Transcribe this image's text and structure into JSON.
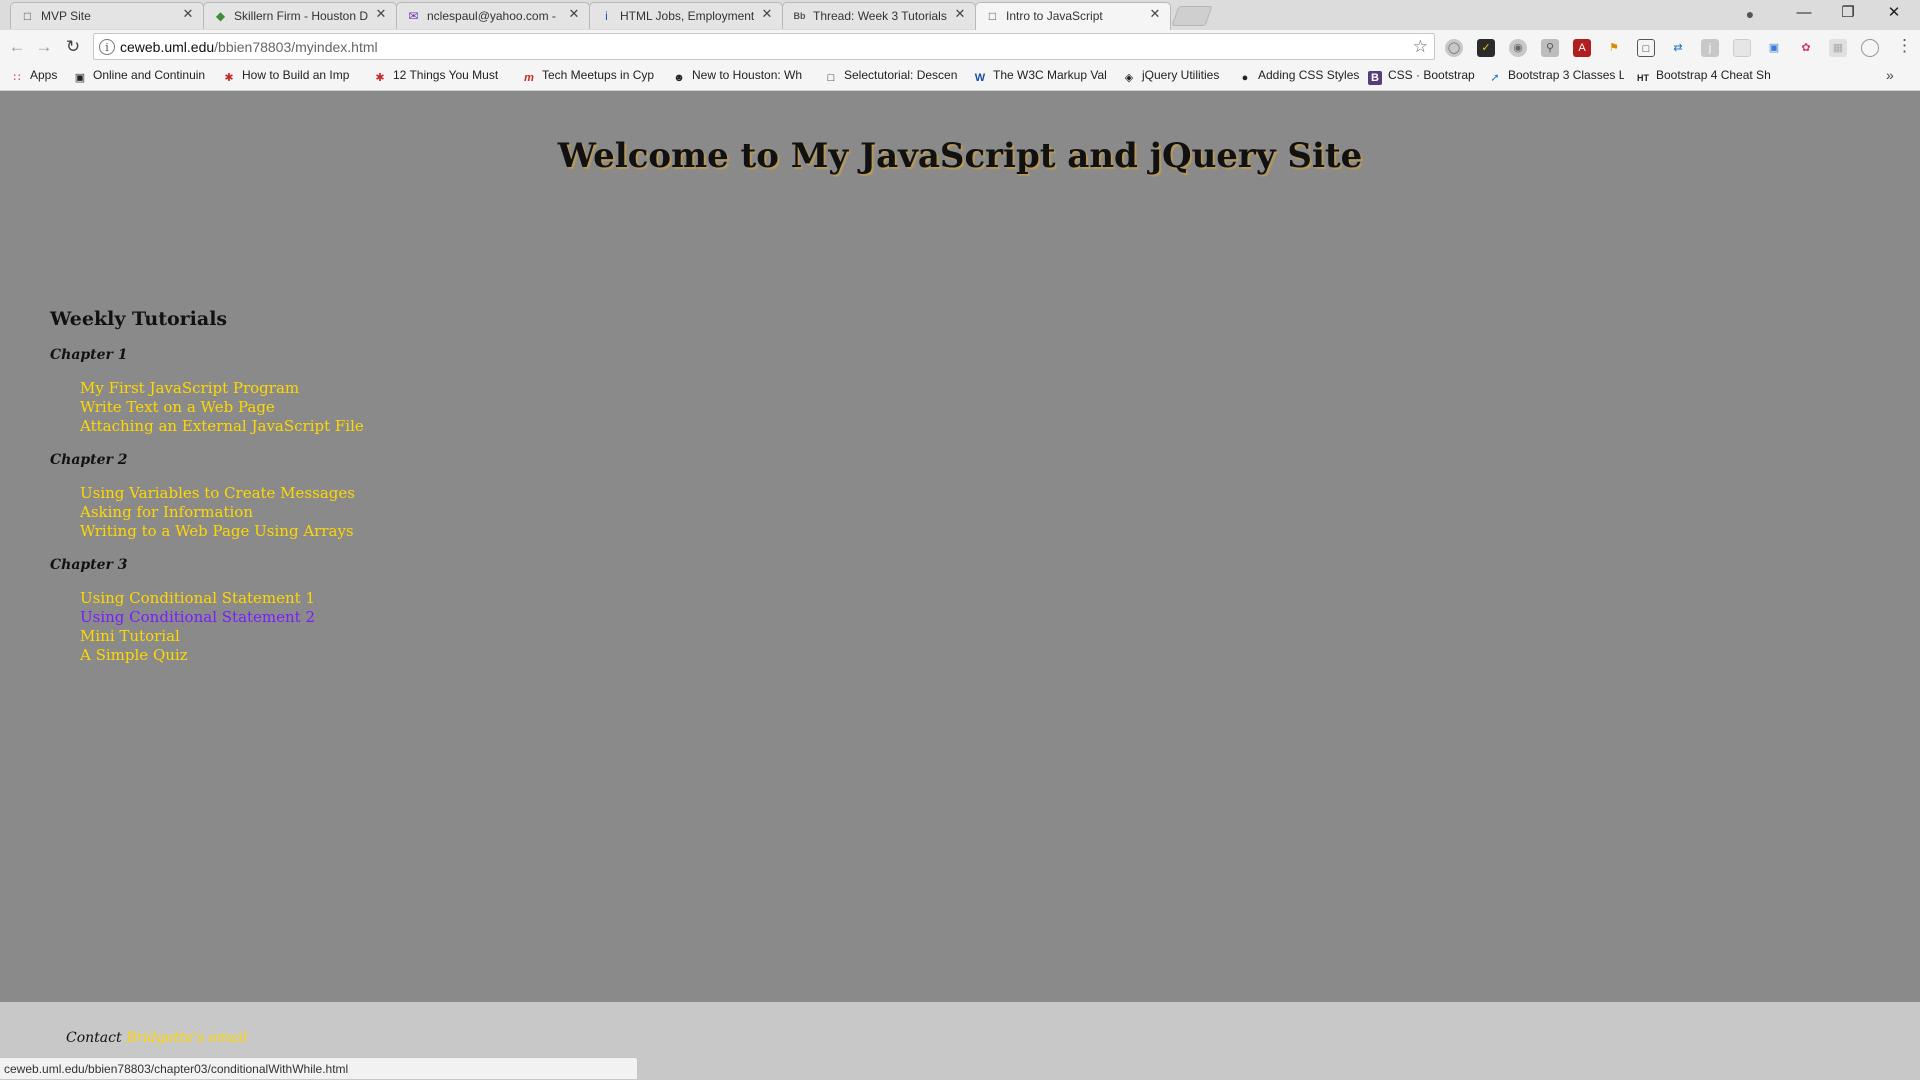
{
  "browser": {
    "tabs": [
      {
        "title": "MVP Site",
        "icon": "page-icon"
      },
      {
        "title": "Skillern Firm - Houston D",
        "icon": "maps-icon"
      },
      {
        "title": "nclespaul@yahoo.com -",
        "icon": "mail-icon"
      },
      {
        "title": "HTML Jobs, Employment",
        "icon": "indeed-icon"
      },
      {
        "title": "Thread: Week 3 Tutorials",
        "icon": "bb-icon"
      },
      {
        "title": "Intro to JavaScript",
        "icon": "page-icon"
      }
    ],
    "active_tab": 5,
    "url_host": "ceweb.uml.edu",
    "url_path": "/bbien78803/myindex.html",
    "bookmarks": [
      {
        "label": "Apps",
        "icon": "apps-grid-icon"
      },
      {
        "label": "Online and Continuin",
        "icon": "bookmark-icon"
      },
      {
        "label": "How to Build an Imp",
        "icon": "bookmark-icon"
      },
      {
        "label": "12 Things You Must",
        "icon": "bookmark-icon"
      },
      {
        "label": "Tech Meetups in Cyp",
        "icon": "bookmark-icon"
      },
      {
        "label": "New to Houston: Wh",
        "icon": "bookmark-icon"
      },
      {
        "label": "Selectutorial: Descen",
        "icon": "page-icon"
      },
      {
        "label": "The W3C Markup Val",
        "icon": "w3c-icon"
      },
      {
        "label": "jQuery Utilities",
        "icon": "bookmark-icon"
      },
      {
        "label": "Adding CSS Styles",
        "icon": "apple-icon"
      },
      {
        "label": "CSS · Bootstrap",
        "icon": "bootstrap-icon"
      },
      {
        "label": "Bootstrap 3 Classes L",
        "icon": "bookmark-icon"
      },
      {
        "label": "Bootstrap 4 Cheat Sh",
        "icon": "bookmark-icon"
      }
    ],
    "status_url": "ceweb.uml.edu/bbien78803/chapter03/conditionalWithWhile.html"
  },
  "page": {
    "heading": "Welcome to My JavaScript and jQuery Site",
    "section_title": "Weekly Tutorials",
    "chapters": [
      {
        "title": "Chapter 1",
        "links": [
          "My First JavaScript Program",
          "Write Text on a Web Page",
          "Attaching an External JavaScript File"
        ]
      },
      {
        "title": "Chapter 2",
        "links": [
          "Using Variables to Create Messages",
          "Asking for Information",
          "Writing to a Web Page Using Arrays"
        ]
      },
      {
        "title": "Chapter 3",
        "links": [
          "Using Conditional Statement 1",
          "Using Conditional Statement 2",
          "Mini Tutorial",
          "A Simple Quiz"
        ]
      }
    ],
    "visited_link": "Using Conditional Statement 2",
    "footer_label": "Contact",
    "footer_link": "Bridgette's email"
  },
  "colors": {
    "page_bg": "#8a8a8a",
    "link": "#ffd800",
    "visited_link": "#7a1cff",
    "footer_bg": "#c8c8c8"
  }
}
